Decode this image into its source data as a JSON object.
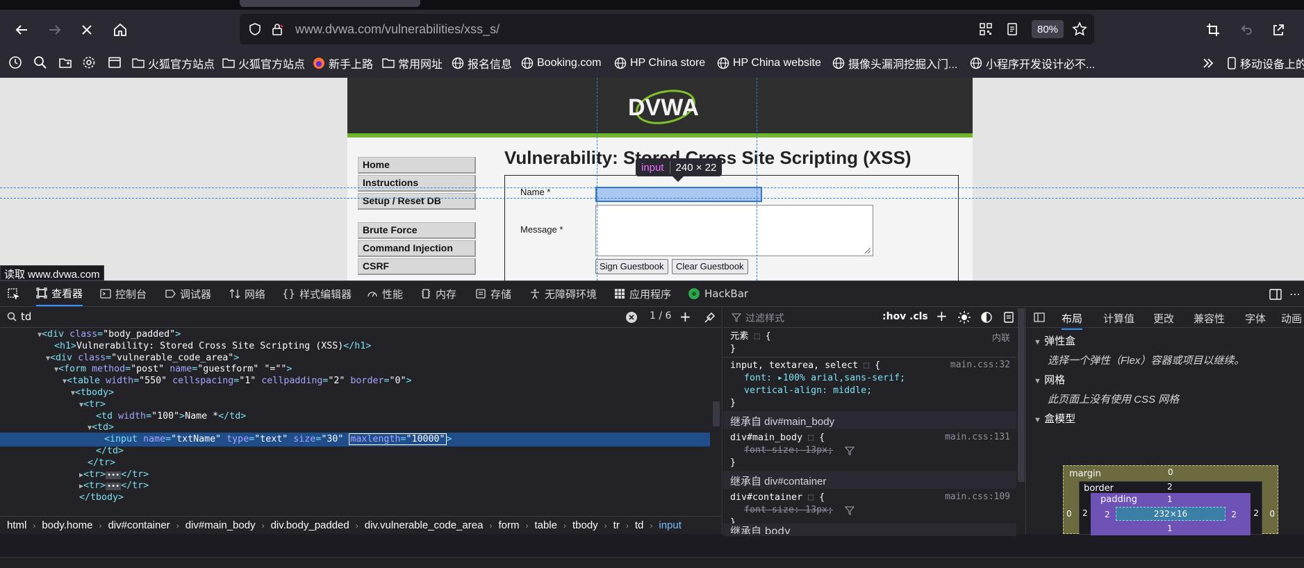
{
  "browser": {
    "url_domain": "www.dvwa.com",
    "url_path": "/vulnerabilities/xss_s/",
    "zoom": "80%",
    "bookmarks": [
      "火狐官方站点",
      "火狐官方站点",
      "新手上路",
      "常用网址",
      "报名信息",
      "Booking.com",
      "HP China store",
      "HP China website",
      "摄像头漏洞挖掘入门...",
      "小程序开发设计必不...",
      "移动设备上的"
    ]
  },
  "page": {
    "logo": "DVWA",
    "menu": [
      "Home",
      "Instructions",
      "Setup / Reset DB",
      "Brute Force",
      "Command Injection",
      "CSRF"
    ],
    "title": "Vulnerability: Stored Cross Site Scripting (XSS)",
    "form": {
      "name_label": "Name *",
      "message_label": "Message *",
      "sign_button": "Sign Guestbook",
      "clear_button": "Clear Guestbook"
    },
    "highlight_tooltip": {
      "tag": "input",
      "size": "240 × 22"
    },
    "status": "读取 www.dvwa.com"
  },
  "devtools": {
    "tabs": [
      "查看器",
      "控制台",
      "调试器",
      "网络",
      "样式编辑器",
      "性能",
      "内存",
      "存储",
      "无障碍环境",
      "应用程序",
      "HackBar"
    ],
    "search_value": "td",
    "search_count": "1 / 6",
    "markup_lines": [
      {
        "indent": 4,
        "html": "<span class=\"tri\">▼</span><span class=\"tg\">&lt;div </span><span class=\"at\">class</span><span class=\"tg\">=</span><span class=\"av\">\"body_padded\"</span><span class=\"tg\">&gt;</span>"
      },
      {
        "indent": 6,
        "html": "<span class=\"tg\">&lt;h1&gt;</span><span class=\"tx\">Vulnerability: Stored Cross Site Scripting (XSS)</span><span class=\"tg\">&lt;/h1&gt;</span>"
      },
      {
        "indent": 5,
        "html": "<span class=\"tri\">▼</span><span class=\"tg\">&lt;div </span><span class=\"at\">class</span><span class=\"tg\">=</span><span class=\"av\">\"vulnerable_code_area\"</span><span class=\"tg\">&gt;</span>"
      },
      {
        "indent": 6,
        "html": "<span class=\"tri\">▼</span><span class=\"tg\">&lt;form </span><span class=\"at\">method</span><span class=\"tg\">=</span><span class=\"av\">\"post\"</span> <span class=\"at\">name</span><span class=\"tg\">=</span><span class=\"av\">\"guestform\"</span> <span class=\"av\">\"=\"\"</span><span class=\"tg\">&gt;</span>"
      },
      {
        "indent": 7,
        "html": "<span class=\"tri\">▼</span><span class=\"tg\">&lt;table </span><span class=\"at\">width</span><span class=\"tg\">=</span><span class=\"av\">\"550\"</span> <span class=\"at\">cellspacing</span><span class=\"tg\">=</span><span class=\"av\">\"1\"</span> <span class=\"at\">cellpadding</span><span class=\"tg\">=</span><span class=\"av\">\"2\"</span> <span class=\"at\">border</span><span class=\"tg\">=</span><span class=\"av\">\"0\"</span><span class=\"tg\">&gt;</span>"
      },
      {
        "indent": 8,
        "html": "<span class=\"tri\">▼</span><span class=\"tg\">&lt;tbody&gt;</span>"
      },
      {
        "indent": 9,
        "html": "<span class=\"tri\">▼</span><span class=\"tg\">&lt;tr&gt;</span>"
      },
      {
        "indent": 11,
        "html": "<span class=\"tg\">&lt;td </span><span class=\"at\">width</span><span class=\"tg\">=</span><span class=\"av\">\"100\"</span><span class=\"tg\">&gt;</span><span class=\"tx\">Name *</span><span class=\"tg\">&lt;/td&gt;</span>"
      },
      {
        "indent": 10,
        "html": "<span class=\"tri\">▼</span><span class=\"tg\">&lt;td&gt;</span>"
      },
      {
        "indent": 12,
        "sel": true,
        "html": "<span class=\"tg\">&lt;input </span><span class=\"at\">name</span><span class=\"tg\">=</span><span class=\"av\">\"txtName\"</span> <span class=\"at\">type</span><span class=\"tg\">=</span><span class=\"av\">\"text\"</span> <span class=\"at\">size</span><span class=\"tg\">=</span><span class=\"av\">\"30\"</span> <span style=\"border:1px solid #fff;padding:0 1px\"><span class=\"at\">maxlength</span><span class=\"tg\">=</span><span class=\"av\">\"10000\"</span></span><span class=\"tg\">&gt;</span>"
      },
      {
        "indent": 11,
        "html": "<span class=\"tg\">&lt;/td&gt;</span>"
      },
      {
        "indent": 10,
        "html": "<span class=\"tg\">&lt;/tr&gt;</span>"
      },
      {
        "indent": 9,
        "html": "<span class=\"tri\">▶</span><span class=\"tg\">&lt;tr&gt;</span><span style=\"background:#4a4a55;padding:0 2px;font-size:10px\">•••</span><span class=\"tg\">&lt;/tr&gt;</span>"
      },
      {
        "indent": 9,
        "html": "<span class=\"tri\">▶</span><span class=\"tg\">&lt;tr&gt;</span><span style=\"background:#4a4a55;padding:0 2px;font-size:10px\">•••</span><span class=\"tg\">&lt;/tr&gt;</span>"
      },
      {
        "indent": 9,
        "html": "<span class=\"tg\">&lt;/tbody&gt;</span>"
      }
    ],
    "breadcrumbs": [
      "html",
      "body.home",
      "div#container",
      "div#main_body",
      "div.body_padded",
      "div.vulnerable_code_area",
      "form",
      "table",
      "tbody",
      "tr",
      "td",
      "input"
    ],
    "rules_filter_placeholder": "过滤样式",
    "rules_hov": ":hov",
    "rules_cls": ".cls",
    "element_rule": {
      "selector": "元素",
      "source": "内联"
    },
    "rule1": {
      "selector": "input, textarea, select",
      "source": "main.css:32",
      "props": [
        "font: ▸100% arial,sans-serif;",
        "vertical-align: middle;"
      ]
    },
    "inherit1": "继承自 div#main_body",
    "rule2": {
      "selector": "div#main_body",
      "source": "main.css:131",
      "prop": "font-size: 13px;"
    },
    "inherit2": "继承自 div#container",
    "rule3": {
      "selector": "div#container",
      "source": "main.css:109",
      "prop": "font-size: 13px;"
    },
    "inherit3": "继承自 body",
    "layout_tabs": [
      "布局",
      "计算值",
      "更改",
      "兼容性",
      "字体",
      "动画"
    ],
    "flex_title": "弹性盒",
    "flex_hint": "选择一个弹性（Flex）容器或项目以继续。",
    "grid_title": "网格",
    "grid_hint": "此页面上没有使用 CSS 网格",
    "boxmodel_title": "盒模型",
    "boxmodel": {
      "margin_label": "margin",
      "border_label": "border",
      "padding_label": "padding",
      "margin": "0",
      "border": "2",
      "padding": "1",
      "pad_side": "2",
      "content": "232×16"
    }
  }
}
